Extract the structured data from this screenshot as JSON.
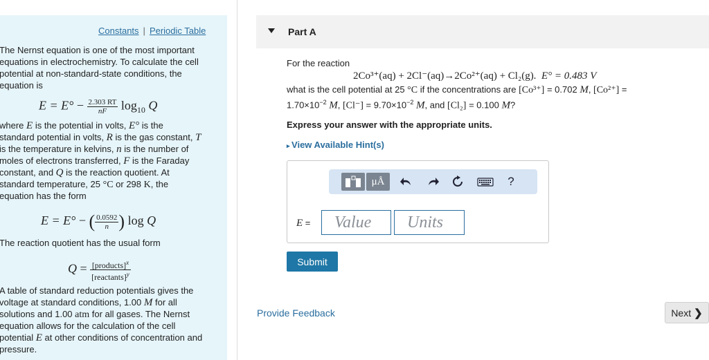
{
  "left": {
    "links": {
      "constants": "Constants",
      "separator": "|",
      "periodic_table": "Periodic Table"
    },
    "intro": [
      "The Nernst equation is one of the most important",
      "equations in electrochemistry. To calculate the cell",
      "potential at non-standard-state conditions, the",
      "equation is"
    ],
    "eq1": {
      "lhs": "E = E°",
      "minus": "−",
      "num": "2.303 RT",
      "den": "nF",
      "log": "log",
      "log_sub": "10",
      "q": "Q"
    },
    "where": [
      [
        "where ",
        "E",
        " is the potential in volts, ",
        "E°",
        " is the"
      ],
      [
        "standard potential in volts, ",
        "R",
        " is the gas constant, ",
        "T",
        ""
      ],
      [
        "is the temperature in kelvins, ",
        "n",
        " is the number of",
        "",
        ""
      ],
      [
        "moles of electrons transferred, ",
        "F",
        " is the Faraday",
        "",
        ""
      ],
      [
        "constant, and ",
        "Q",
        " is the reaction quotient. At",
        "",
        ""
      ],
      [
        "standard temperature, 25 ",
        "°C",
        " or 298 ",
        "K",
        ", the"
      ],
      [
        "equation has the form",
        "",
        "",
        "",
        ""
      ]
    ],
    "eq2": {
      "lhs": "E = E°",
      "minus": "−",
      "num": "0.0592",
      "den": "n",
      "log": "log",
      "q": "Q"
    },
    "quotient_intro": "The reaction quotient has the usual form",
    "eq3": {
      "lhs": "Q =",
      "num": "[products]",
      "num_exp": "x",
      "den": "[reactants]",
      "den_exp": "y"
    },
    "table_text": [
      [
        "A table of standard reduction potentials gives the",
        "",
        ""
      ],
      [
        "voltage at standard conditions, 1.00 ",
        "M",
        " for all"
      ],
      [
        "solutions and 1.00 ",
        "atm",
        " for all gases. The Nernst"
      ],
      [
        "equation allows for the calculation of the cell",
        "",
        ""
      ],
      [
        "potential ",
        "E",
        " at other conditions of concentration and"
      ],
      [
        "pressure.",
        "",
        ""
      ]
    ]
  },
  "part": {
    "title": "Part A"
  },
  "question": {
    "for_reaction": "For the reaction",
    "reaction": "2Co³⁺(aq) + 2Cl⁻(aq)→2Co²⁺(aq) + Cl₂(g).",
    "e_std": "E° = 0.483 V",
    "line1": [
      "what is the cell potential at 25 ",
      "°C",
      " if the concentrations are ",
      "[Co³⁺]",
      " = 0.702 ",
      "M",
      ", ",
      "[Co²⁺]",
      " ="
    ],
    "line2": [
      "1.70×10",
      "−2",
      " ",
      "M",
      ", ",
      "[Cl⁻]",
      " = 9.70×10",
      "−2",
      " ",
      "M",
      ", and ",
      "[Cl₂]",
      " = 0.100 ",
      "M",
      "?"
    ],
    "instruction": "Express your answer with the appropriate units.",
    "hint_link": "View Available Hint(s)"
  },
  "answer": {
    "toolbar": {
      "mu_label": "μÅ",
      "help_label": "?"
    },
    "e_label": "E",
    "e_equals": " =",
    "value_placeholder": "Value",
    "units_placeholder": "Units"
  },
  "actions": {
    "submit": "Submit",
    "feedback": "Provide Feedback",
    "next": "Next"
  },
  "colors": {
    "left_panel_bg": "#e6f5fa",
    "link": "#2a6e9e",
    "submit_bg": "#1e77a6",
    "toolbar_bg": "#d6e4f3"
  }
}
